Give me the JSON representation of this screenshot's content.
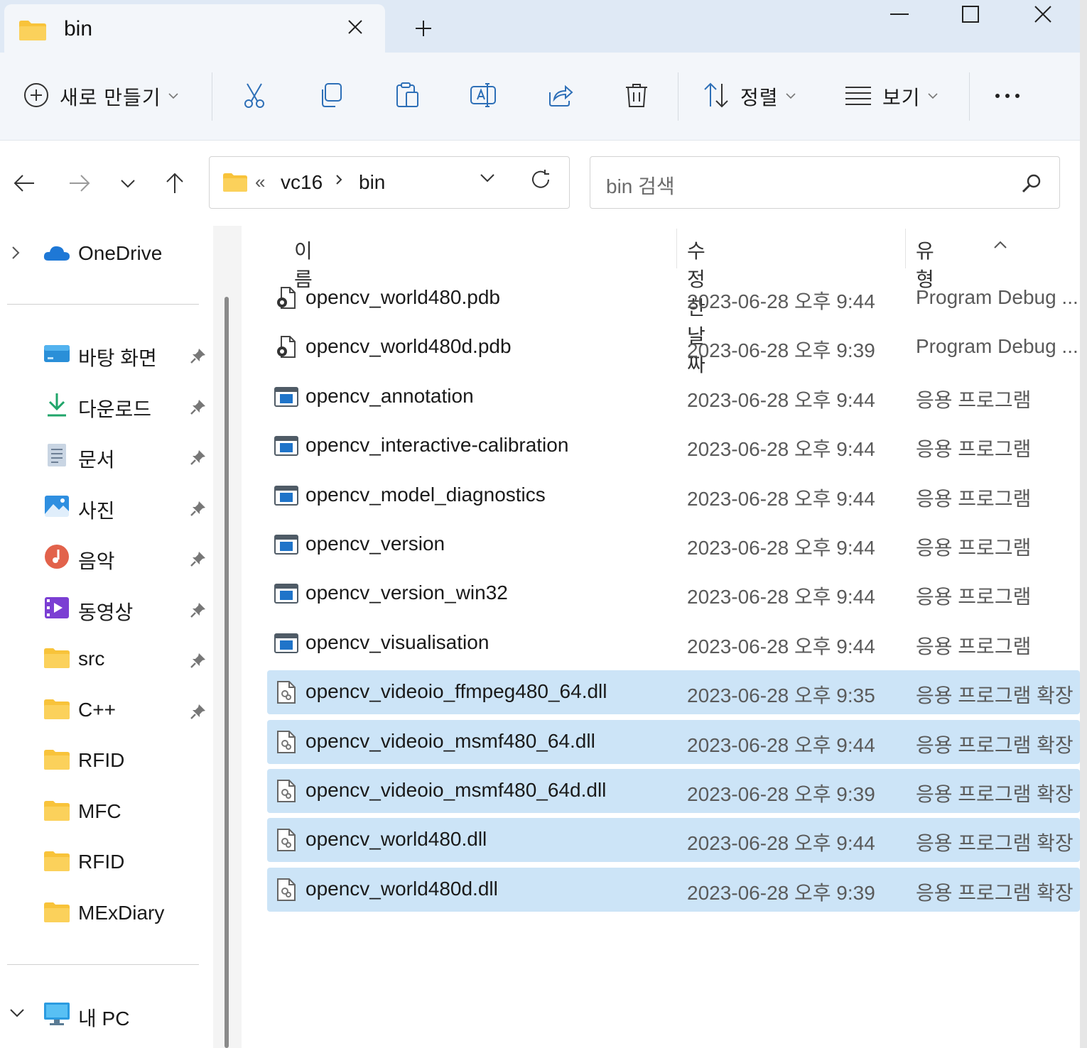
{
  "window": {
    "tab_title": "bin",
    "new_tab_symbol": "+"
  },
  "commandbar": {
    "new_label": "새로 만들기",
    "sort_label": "정렬",
    "view_label": "보기",
    "more_label": "···"
  },
  "nav": {
    "crumb_prefix": "«",
    "crumbs": [
      "vc16",
      "bin"
    ],
    "search_placeholder": "bin 검색"
  },
  "sidebar": {
    "onedrive": "OneDrive",
    "quick": [
      {
        "label": "바탕 화면",
        "icon": "desktop-icon"
      },
      {
        "label": "다운로드",
        "icon": "download-icon"
      },
      {
        "label": "문서",
        "icon": "document-icon"
      },
      {
        "label": "사진",
        "icon": "pictures-icon"
      },
      {
        "label": "음악",
        "icon": "music-icon"
      },
      {
        "label": "동영상",
        "icon": "video-icon"
      },
      {
        "label": "src",
        "icon": "folder-icon"
      },
      {
        "label": "C++",
        "icon": "folder-icon"
      },
      {
        "label": "RFID",
        "icon": "folder-icon"
      },
      {
        "label": "MFC",
        "icon": "folder-icon"
      },
      {
        "label": "RFID",
        "icon": "folder-icon"
      },
      {
        "label": "MExDiary",
        "icon": "folder-icon"
      }
    ],
    "this_pc": "내 PC"
  },
  "columns": {
    "name": "이름",
    "date": "수정한 날짜",
    "type": "유형"
  },
  "files": [
    {
      "name": "opencv_world480.pdb",
      "date": "2023-06-28 오후 9:44",
      "type": "Program Debug ...",
      "kind": "pdb",
      "selected": false
    },
    {
      "name": "opencv_world480d.pdb",
      "date": "2023-06-28 오후 9:39",
      "type": "Program Debug ...",
      "kind": "pdb",
      "selected": false
    },
    {
      "name": "opencv_annotation",
      "date": "2023-06-28 오후 9:44",
      "type": "응용 프로그램",
      "kind": "exe",
      "selected": false
    },
    {
      "name": "opencv_interactive-calibration",
      "date": "2023-06-28 오후 9:44",
      "type": "응용 프로그램",
      "kind": "exe",
      "selected": false
    },
    {
      "name": "opencv_model_diagnostics",
      "date": "2023-06-28 오후 9:44",
      "type": "응용 프로그램",
      "kind": "exe",
      "selected": false
    },
    {
      "name": "opencv_version",
      "date": "2023-06-28 오후 9:44",
      "type": "응용 프로그램",
      "kind": "exe",
      "selected": false
    },
    {
      "name": "opencv_version_win32",
      "date": "2023-06-28 오후 9:44",
      "type": "응용 프로그램",
      "kind": "exe",
      "selected": false
    },
    {
      "name": "opencv_visualisation",
      "date": "2023-06-28 오후 9:44",
      "type": "응용 프로그램",
      "kind": "exe",
      "selected": false
    },
    {
      "name": "opencv_videoio_ffmpeg480_64.dll",
      "date": "2023-06-28 오후 9:35",
      "type": "응용 프로그램 확장",
      "kind": "dll",
      "selected": true
    },
    {
      "name": "opencv_videoio_msmf480_64.dll",
      "date": "2023-06-28 오후 9:44",
      "type": "응용 프로그램 확장",
      "kind": "dll",
      "selected": true
    },
    {
      "name": "opencv_videoio_msmf480_64d.dll",
      "date": "2023-06-28 오후 9:39",
      "type": "응용 프로그램 확장",
      "kind": "dll",
      "selected": true
    },
    {
      "name": "opencv_world480.dll",
      "date": "2023-06-28 오후 9:44",
      "type": "응용 프로그램 확장",
      "kind": "dll",
      "selected": true
    },
    {
      "name": "opencv_world480d.dll",
      "date": "2023-06-28 오후 9:39",
      "type": "응용 프로그램 확장",
      "kind": "dll",
      "selected": true
    }
  ],
  "colors": {
    "selection": "#cce4f7",
    "titlebar": "#dfe9f5",
    "commandbar": "#f3f6fa",
    "folder": "#f8c33a"
  }
}
